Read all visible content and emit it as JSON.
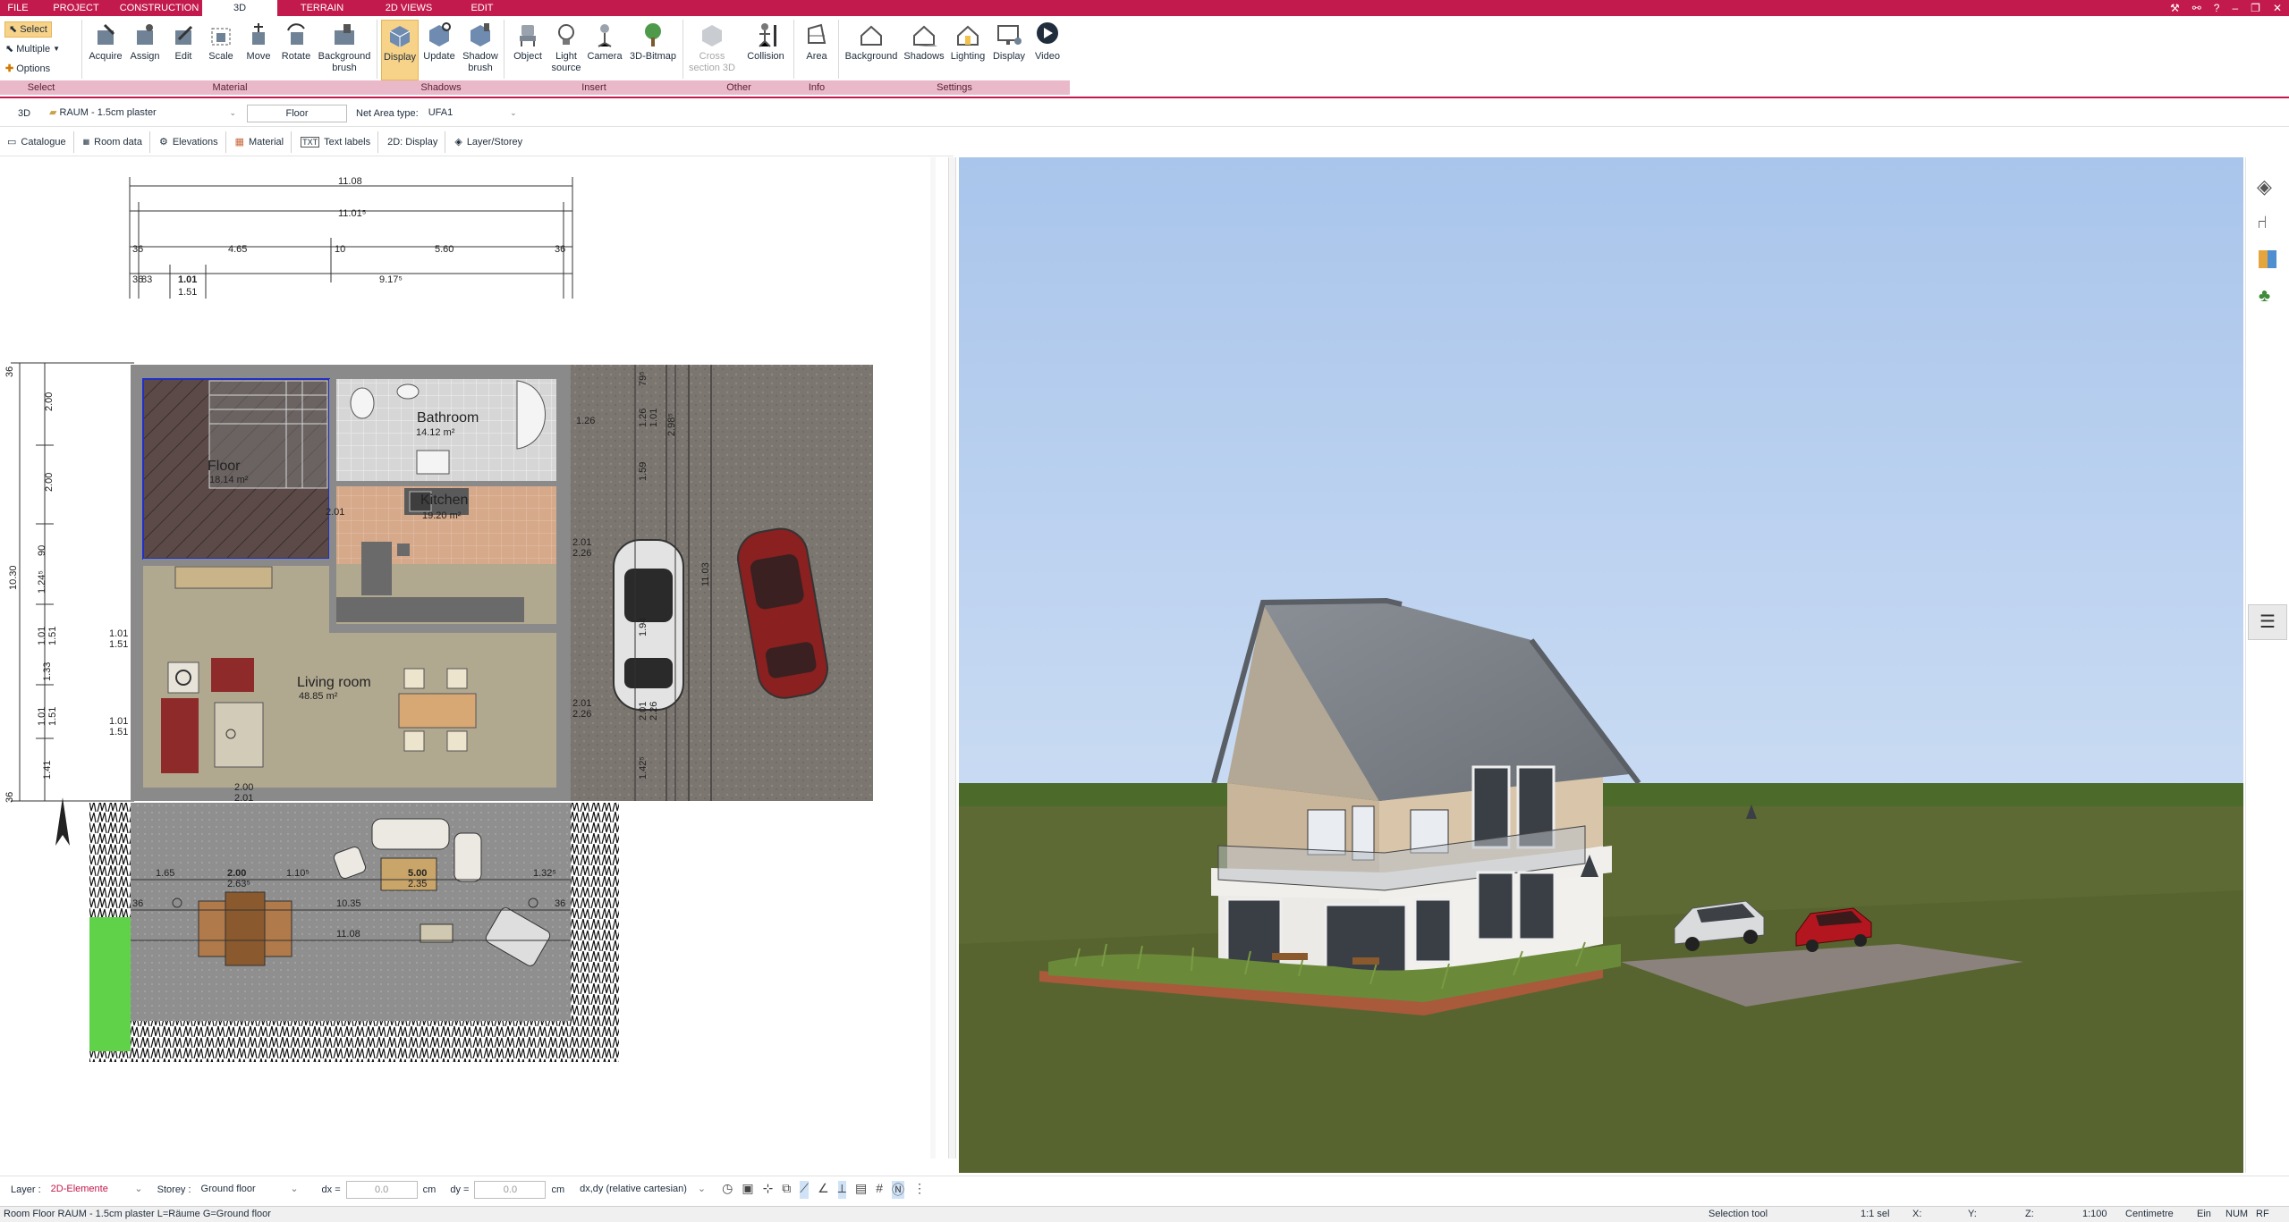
{
  "tabs": [
    {
      "label": "FILE",
      "active": false
    },
    {
      "label": "PROJECT",
      "active": false
    },
    {
      "label": "CONSTRUCTION",
      "active": false
    },
    {
      "label": "3D",
      "active": true
    },
    {
      "label": "TERRAIN",
      "active": false
    },
    {
      "label": "2D VIEWS",
      "active": false
    },
    {
      "label": "EDIT",
      "active": false
    }
  ],
  "select_group": {
    "select": "Select",
    "multiple": "Multiple",
    "options": "Options",
    "group": "Select"
  },
  "ribbon": {
    "material": {
      "group": "Material",
      "buttons": [
        "Acquire",
        "Assign",
        "Edit",
        "Scale",
        "Move",
        "Rotate",
        "Background brush"
      ]
    },
    "shadows": {
      "group": "Shadows",
      "buttons": [
        "Display",
        "Update",
        "Shadow brush"
      ]
    },
    "insert": {
      "group": "Insert",
      "buttons": [
        "Object",
        "Light source",
        "Camera",
        "3D-Bitmap"
      ]
    },
    "other": {
      "group": "Other",
      "buttons": [
        "Cross section 3D",
        "Collision"
      ]
    },
    "info": {
      "group": "Info",
      "buttons": [
        "Area"
      ]
    },
    "settings": {
      "group": "Settings",
      "buttons": [
        "Background",
        "Shadows",
        "Lighting",
        "Display",
        "Video"
      ]
    }
  },
  "options_bar": {
    "mode": "3D",
    "room_type": "RAUM - 1.5cm plaster",
    "room_name": "Floor",
    "net_area_label": "Net Area type:",
    "net_area_value": "UFA1"
  },
  "view_tabs": [
    "Catalogue",
    "Room data",
    "Elevations",
    "Material",
    "Text labels",
    "2D: Display",
    "Layer/Storey"
  ],
  "plan": {
    "rooms": [
      {
        "name": "Bathroom",
        "area": "14.12 m²"
      },
      {
        "name": "Floor",
        "area": "18.14 m²"
      },
      {
        "name": "Kitchen",
        "area": "19.20 m²"
      },
      {
        "name": "Living room",
        "area": "48.85 m²"
      }
    ],
    "dims_top": [
      "11.08",
      "11.01⁵",
      "4.65",
      "5.60",
      "1.01",
      "1.51",
      "9.17⁵",
      "83",
      "36",
      "10",
      "36",
      "36"
    ],
    "dims_left": [
      "36",
      "2.00",
      "2.00",
      "90",
      "10.30",
      "1.24⁵",
      "1.01",
      "1.51",
      "1.33",
      "1.01",
      "1.51",
      "1.41",
      "36"
    ],
    "dims_right": [
      "79⁵",
      "36",
      "1.26",
      "1.01",
      "2.98⁵",
      "1.59",
      "10",
      "2.01",
      "2.26",
      "11.03",
      "1.94",
      "2.01",
      "2.26",
      "2.01",
      "2.26",
      "1.42⁵",
      "36"
    ],
    "dims_terrace": [
      "1.65",
      "2.00",
      "2.63⁵",
      "1.10⁵",
      "5.00",
      "2.35",
      "1.32⁵",
      "36",
      "10.35",
      "36",
      "11.08"
    ],
    "dims_misc": [
      "1.01",
      "1.51",
      "1.01",
      "1.51",
      "2.00",
      "2.01",
      "2.01",
      "2.00"
    ]
  },
  "status_input": {
    "layer_label": "Layer :",
    "layer_value": "2D-Elemente",
    "storey_label": "Storey :",
    "storey_value": "Ground floor",
    "dx_label": "dx =",
    "dx_value": "0.0",
    "dy_label": "dy =",
    "dy_value": "0.0",
    "unit": "cm",
    "coord_mode": "dx,dy (relative cartesian)"
  },
  "statusbar": {
    "text": "Room Floor RAUM - 1.5cm plaster L=Räume G=Ground floor",
    "tool": "Selection tool",
    "sel": "1:1 sel",
    "x": "X:",
    "y": "Y:",
    "z": "Z:",
    "scale": "1:100",
    "unit": "Centimetre",
    "ein": "Ein",
    "num": "NUM",
    "rf": "RF"
  },
  "colors": {
    "accent": "#c21a4c",
    "ribbon_group": "#e9b9c9",
    "active_button": "#f7d389",
    "sky": "#bcd3f0",
    "grass": "#5d6a33"
  }
}
